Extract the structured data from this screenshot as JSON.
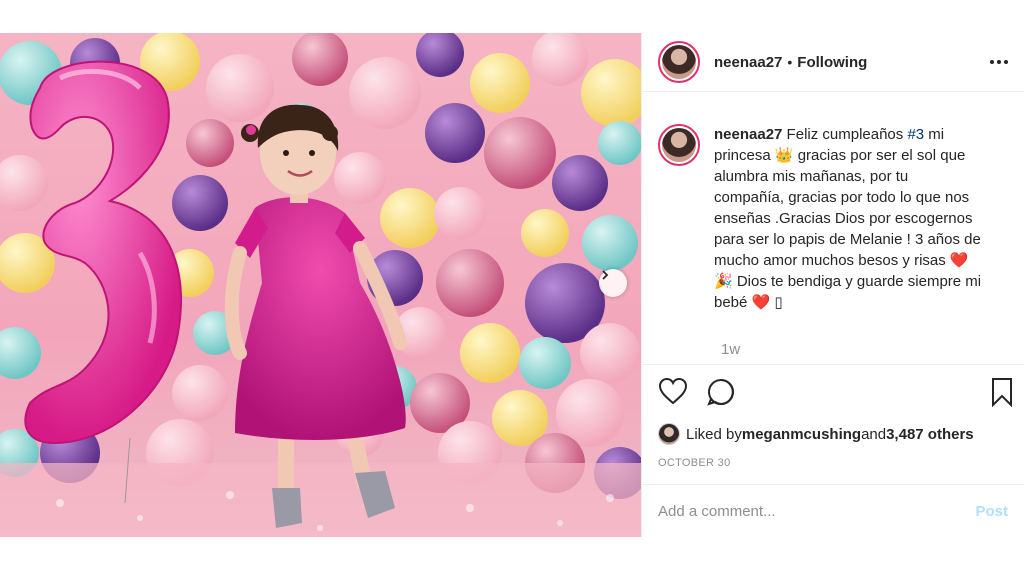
{
  "post": {
    "username": "neenaa27",
    "separator": "•",
    "follow_status": "Following",
    "caption": {
      "username": "neenaa27",
      "text_before_tag": " Feliz cumpleaños ",
      "hashtag": "#3",
      "text_after_tag": " mi princesa 👑 gracias por ser el sol que alumbra mis mañanas, por tu compañía, gracias por todo lo que nos enseñas .Gracias Dios por escogernos para ser lo papis de Melanie ! 3 años de mucho amor muchos besos y risas ❤️🎉 Dios te bendiga y guarde siempre mi bebé ❤️ ▯"
    },
    "time_ago": "1w",
    "likes": {
      "prefix": "Liked by ",
      "user": "meganmcushing",
      "middle": " and ",
      "count": "3,487 others"
    },
    "date": "OCTOBER 30",
    "comment_placeholder": "Add a comment...",
    "post_button": "Post"
  },
  "icons": {
    "heart": "heart-icon",
    "comment": "comment-icon",
    "bookmark": "bookmark-icon",
    "next": "chevron-right-icon",
    "more": "more-options-icon"
  },
  "colors": {
    "accent_pink": "#e1306c",
    "link": "#003569",
    "muted": "#8e8e8e",
    "post_disabled": "#b2dffc"
  }
}
